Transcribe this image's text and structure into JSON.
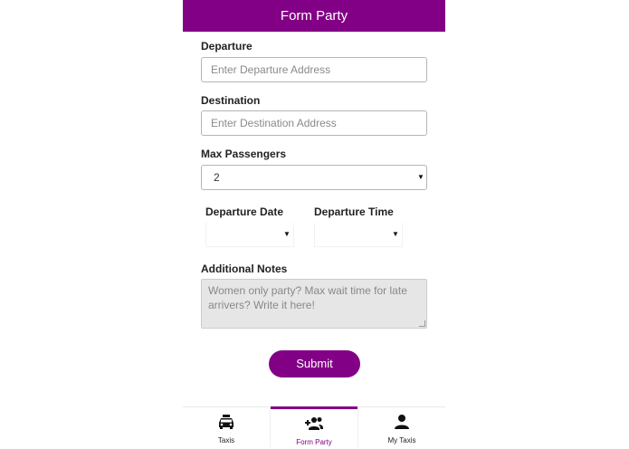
{
  "header": {
    "title": "Form Party"
  },
  "form": {
    "departure": {
      "label": "Departure",
      "placeholder": "Enter Departure Address",
      "value": ""
    },
    "destination": {
      "label": "Destination",
      "placeholder": "Enter Destination Address",
      "value": ""
    },
    "max_passengers": {
      "label": "Max Passengers",
      "selected": "2"
    },
    "departure_date": {
      "label": "Departure Date",
      "selected": ""
    },
    "departure_time": {
      "label": "Departure Time",
      "selected": ""
    },
    "notes": {
      "label": "Additional Notes",
      "placeholder": "Women only party? Max wait time for late arrivers? Write it here!"
    },
    "submit_label": "Submit"
  },
  "tabs": [
    {
      "label": "Taxis",
      "icon": "taxi-icon",
      "active": false
    },
    {
      "label": "Form Party",
      "icon": "add-group-icon",
      "active": true
    },
    {
      "label": "My Taxis",
      "icon": "person-icon",
      "active": false
    }
  ],
  "colors": {
    "accent": "#820085",
    "notes_bg": "#e6e6e6",
    "text": "#222222"
  }
}
